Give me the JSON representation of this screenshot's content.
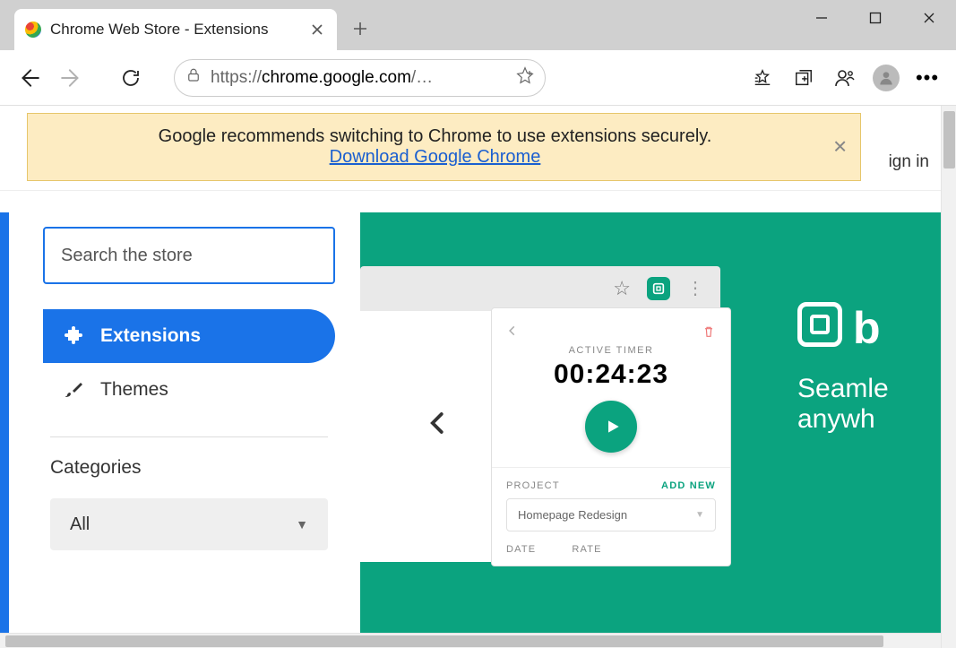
{
  "tab": {
    "title": "Chrome Web Store - Extensions"
  },
  "url": {
    "scheme": "https://",
    "domain": "chrome.google.com",
    "path": "/…"
  },
  "banner": {
    "text": "Google recommends switching to Chrome to use extensions securely.",
    "link": "Download Google Chrome"
  },
  "header": {
    "signin": "ign in"
  },
  "sidebar": {
    "search_placeholder": "Search the store",
    "nav": {
      "extensions": "Extensions",
      "themes": "Themes"
    },
    "categories_title": "Categories",
    "category_selected": "All"
  },
  "hero": {
    "popup": {
      "label": "ACTIVE TIMER",
      "time": "00:24:23",
      "project_label": "PROJECT",
      "add_new": "ADD NEW",
      "project_value": "Homepage Redesign",
      "date_label": "DATE",
      "rate_label": "RATE"
    },
    "brand": {
      "b": "b",
      "tag1": "Seamle",
      "tag2": "anywh"
    }
  }
}
